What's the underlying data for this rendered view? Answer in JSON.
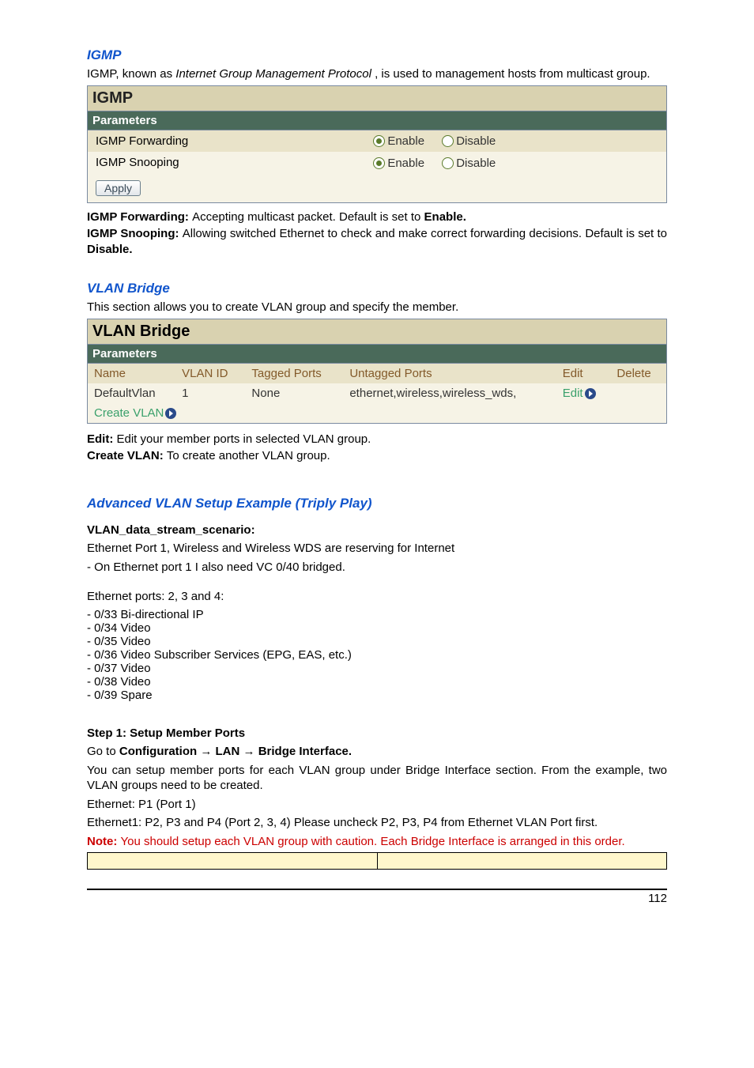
{
  "igmp_heading": "IGMP",
  "igmp_intro_a": "IGMP, known as ",
  "igmp_intro_b": "Internet Group Management Protocol",
  "igmp_intro_c": ", is used to management hosts from multicast group.",
  "igmp_panel": {
    "title": "IGMP",
    "subtitle": "Parameters",
    "rows": [
      {
        "label": "IGMP Forwarding",
        "enable": "Enable",
        "disable": "Disable"
      },
      {
        "label": "IGMP Snooping",
        "enable": "Enable",
        "disable": "Disable"
      }
    ],
    "apply": "Apply"
  },
  "igmp_terms": {
    "fwd_name": "IGMP Forwarding: ",
    "fwd_desc": "Accepting multicast packet.  Default is set to ",
    "fwd_def": "Enable.",
    "snoop_name": "IGMP Snooping: ",
    "snoop_desc1": "Allowing  switched  Ethernet  to  check  and  make  correct  forwarding  decisions. Default is set to ",
    "snoop_def": "Disable."
  },
  "vlan_heading": "VLAN Bridge",
  "vlan_intro": "This section allows you to create VLAN group and specify the member.",
  "vlan_panel": {
    "title": "VLAN Bridge",
    "subtitle": "Parameters",
    "headers": [
      "Name",
      "VLAN ID",
      "Tagged Ports",
      "Untagged Ports",
      "Edit",
      "Delete"
    ],
    "row": {
      "name": "DefaultVlan",
      "vlanid": "1",
      "tagged": "None",
      "untagged": "ethernet,wireless,wireless_wds,",
      "edit": "Edit"
    },
    "create": "Create VLAN"
  },
  "vlan_terms": {
    "edit_name": "Edit: ",
    "edit_desc": "Edit your member ports in selected VLAN group.",
    "create_name": "Create VLAN: ",
    "create_desc": "To create another VLAN group."
  },
  "example_heading": "Advanced VLAN Setup Example (Triply Play)",
  "scenario_label": "VLAN_data_stream_scenario: ",
  "scenario": {
    "line1": "Ethernet Port 1, Wireless and Wireless WDS are reserving for Internet",
    "line2": "- On Ethernet port 1 I also need VC 0/40 bridged.",
    "line3": "Ethernet ports: 2, 3 and 4:",
    "items": [
      "-  0/33 Bi-directional IP",
      "-  0/34  Video",
      "-  0/35  Video",
      "-  0/36  Video Subscriber Services (EPG, EAS, etc.)",
      "-  0/37  Video",
      "-  0/38  Video",
      "-  0/39  Spare"
    ]
  },
  "step1": {
    "label": "Step 1: Setup Member Ports",
    "goto_a": "Go to ",
    "goto_b": "Configuration ",
    "arrow1": "→",
    "goto_c": " LAN ",
    "arrow2": "→",
    "goto_d": " Bridge Interface.",
    "line2": "You  can  setup  member  ports  for  each  VLAN  group  under  Bridge  Interface  section.  From  the example, two VLAN groups need to be created.",
    "line3": "Ethernet: P1 (Port 1)",
    "line4": "Ethernet1: P2, P3 and P4 (Port 2, 3, 4) Please uncheck P2, P3, P4 from Ethernet VLAN Port first.",
    "note_a": "Note: ",
    "note_b": "You should setup each VLAN group with caution.  Each Bridge Interface is arranged in this order."
  },
  "page_number": "112"
}
